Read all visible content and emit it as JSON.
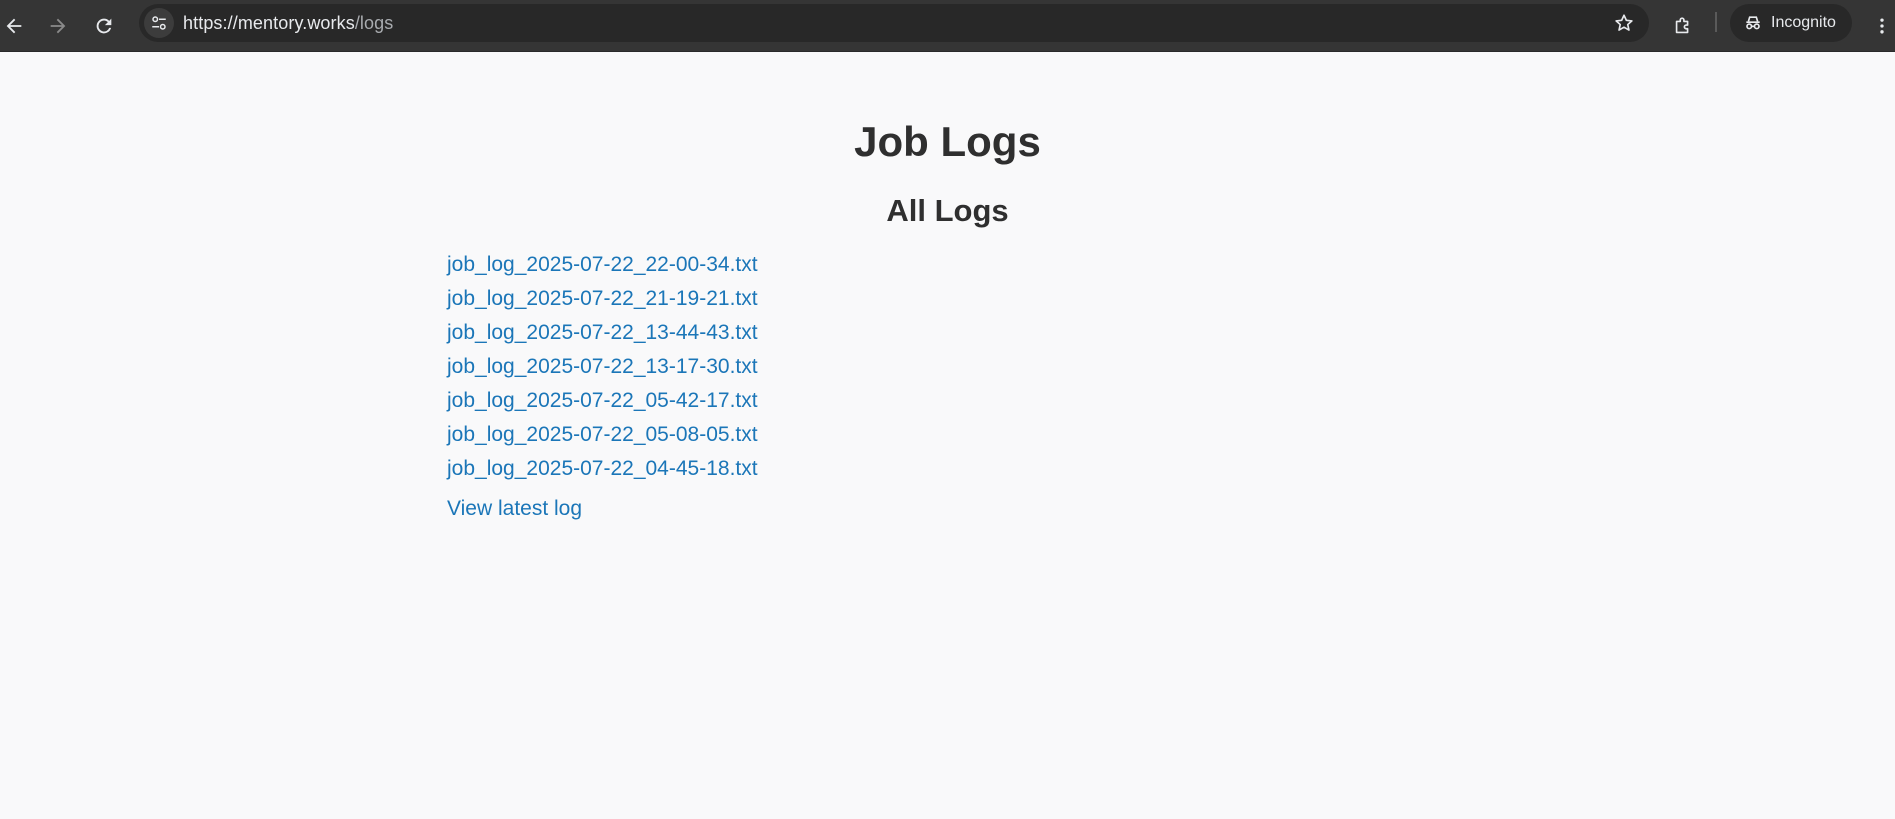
{
  "browser": {
    "url_host": "https://mentory.works",
    "url_path": "/logs",
    "profile_label": "Incognito"
  },
  "page": {
    "title": "Job Logs",
    "subtitle": "All Logs",
    "logs": [
      "job_log_2025-07-22_22-00-34.txt",
      "job_log_2025-07-22_21-19-21.txt",
      "job_log_2025-07-22_13-44-43.txt",
      "job_log_2025-07-22_13-17-30.txt",
      "job_log_2025-07-22_05-42-17.txt",
      "job_log_2025-07-22_05-08-05.txt",
      "job_log_2025-07-22_04-45-18.txt"
    ],
    "latest_link": "View latest log"
  },
  "colors": {
    "link": "#1b76b8",
    "heading": "#2f2f2f",
    "background": "#f9f9fa",
    "toolbar": "#353535"
  }
}
